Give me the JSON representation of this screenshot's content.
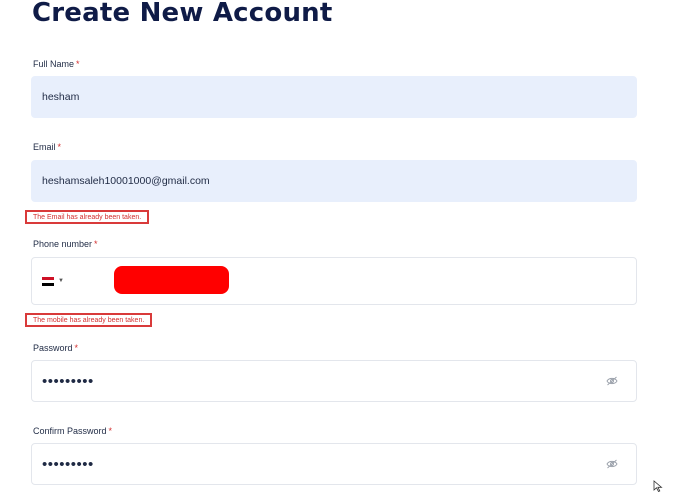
{
  "page": {
    "title": "Create New Account"
  },
  "form": {
    "full_name": {
      "label": "Full Name",
      "required_mark": "*",
      "value": "hesham"
    },
    "email": {
      "label": "Email",
      "required_mark": "*",
      "value": "heshamsaleh10001000@gmail.com",
      "error": "The Email has already been taken."
    },
    "phone": {
      "label": "Phone number",
      "required_mark": "*",
      "country_flag": "egypt-flag-icon",
      "error": "The mobile has already been taken."
    },
    "password": {
      "label": "Password",
      "required_mark": "*",
      "value": "•••••••••"
    },
    "confirm_password": {
      "label": "Confirm Password",
      "required_mark": "*",
      "value": "•••••••••"
    }
  },
  "icons": {
    "toggle_visibility": "eye-slash-icon",
    "cursor": "mouse-pointer-icon"
  },
  "colors": {
    "title": "#0f1b47",
    "filled_input_bg": "#e8effc",
    "error": "#d32f2f",
    "redaction": "#ff0000"
  }
}
